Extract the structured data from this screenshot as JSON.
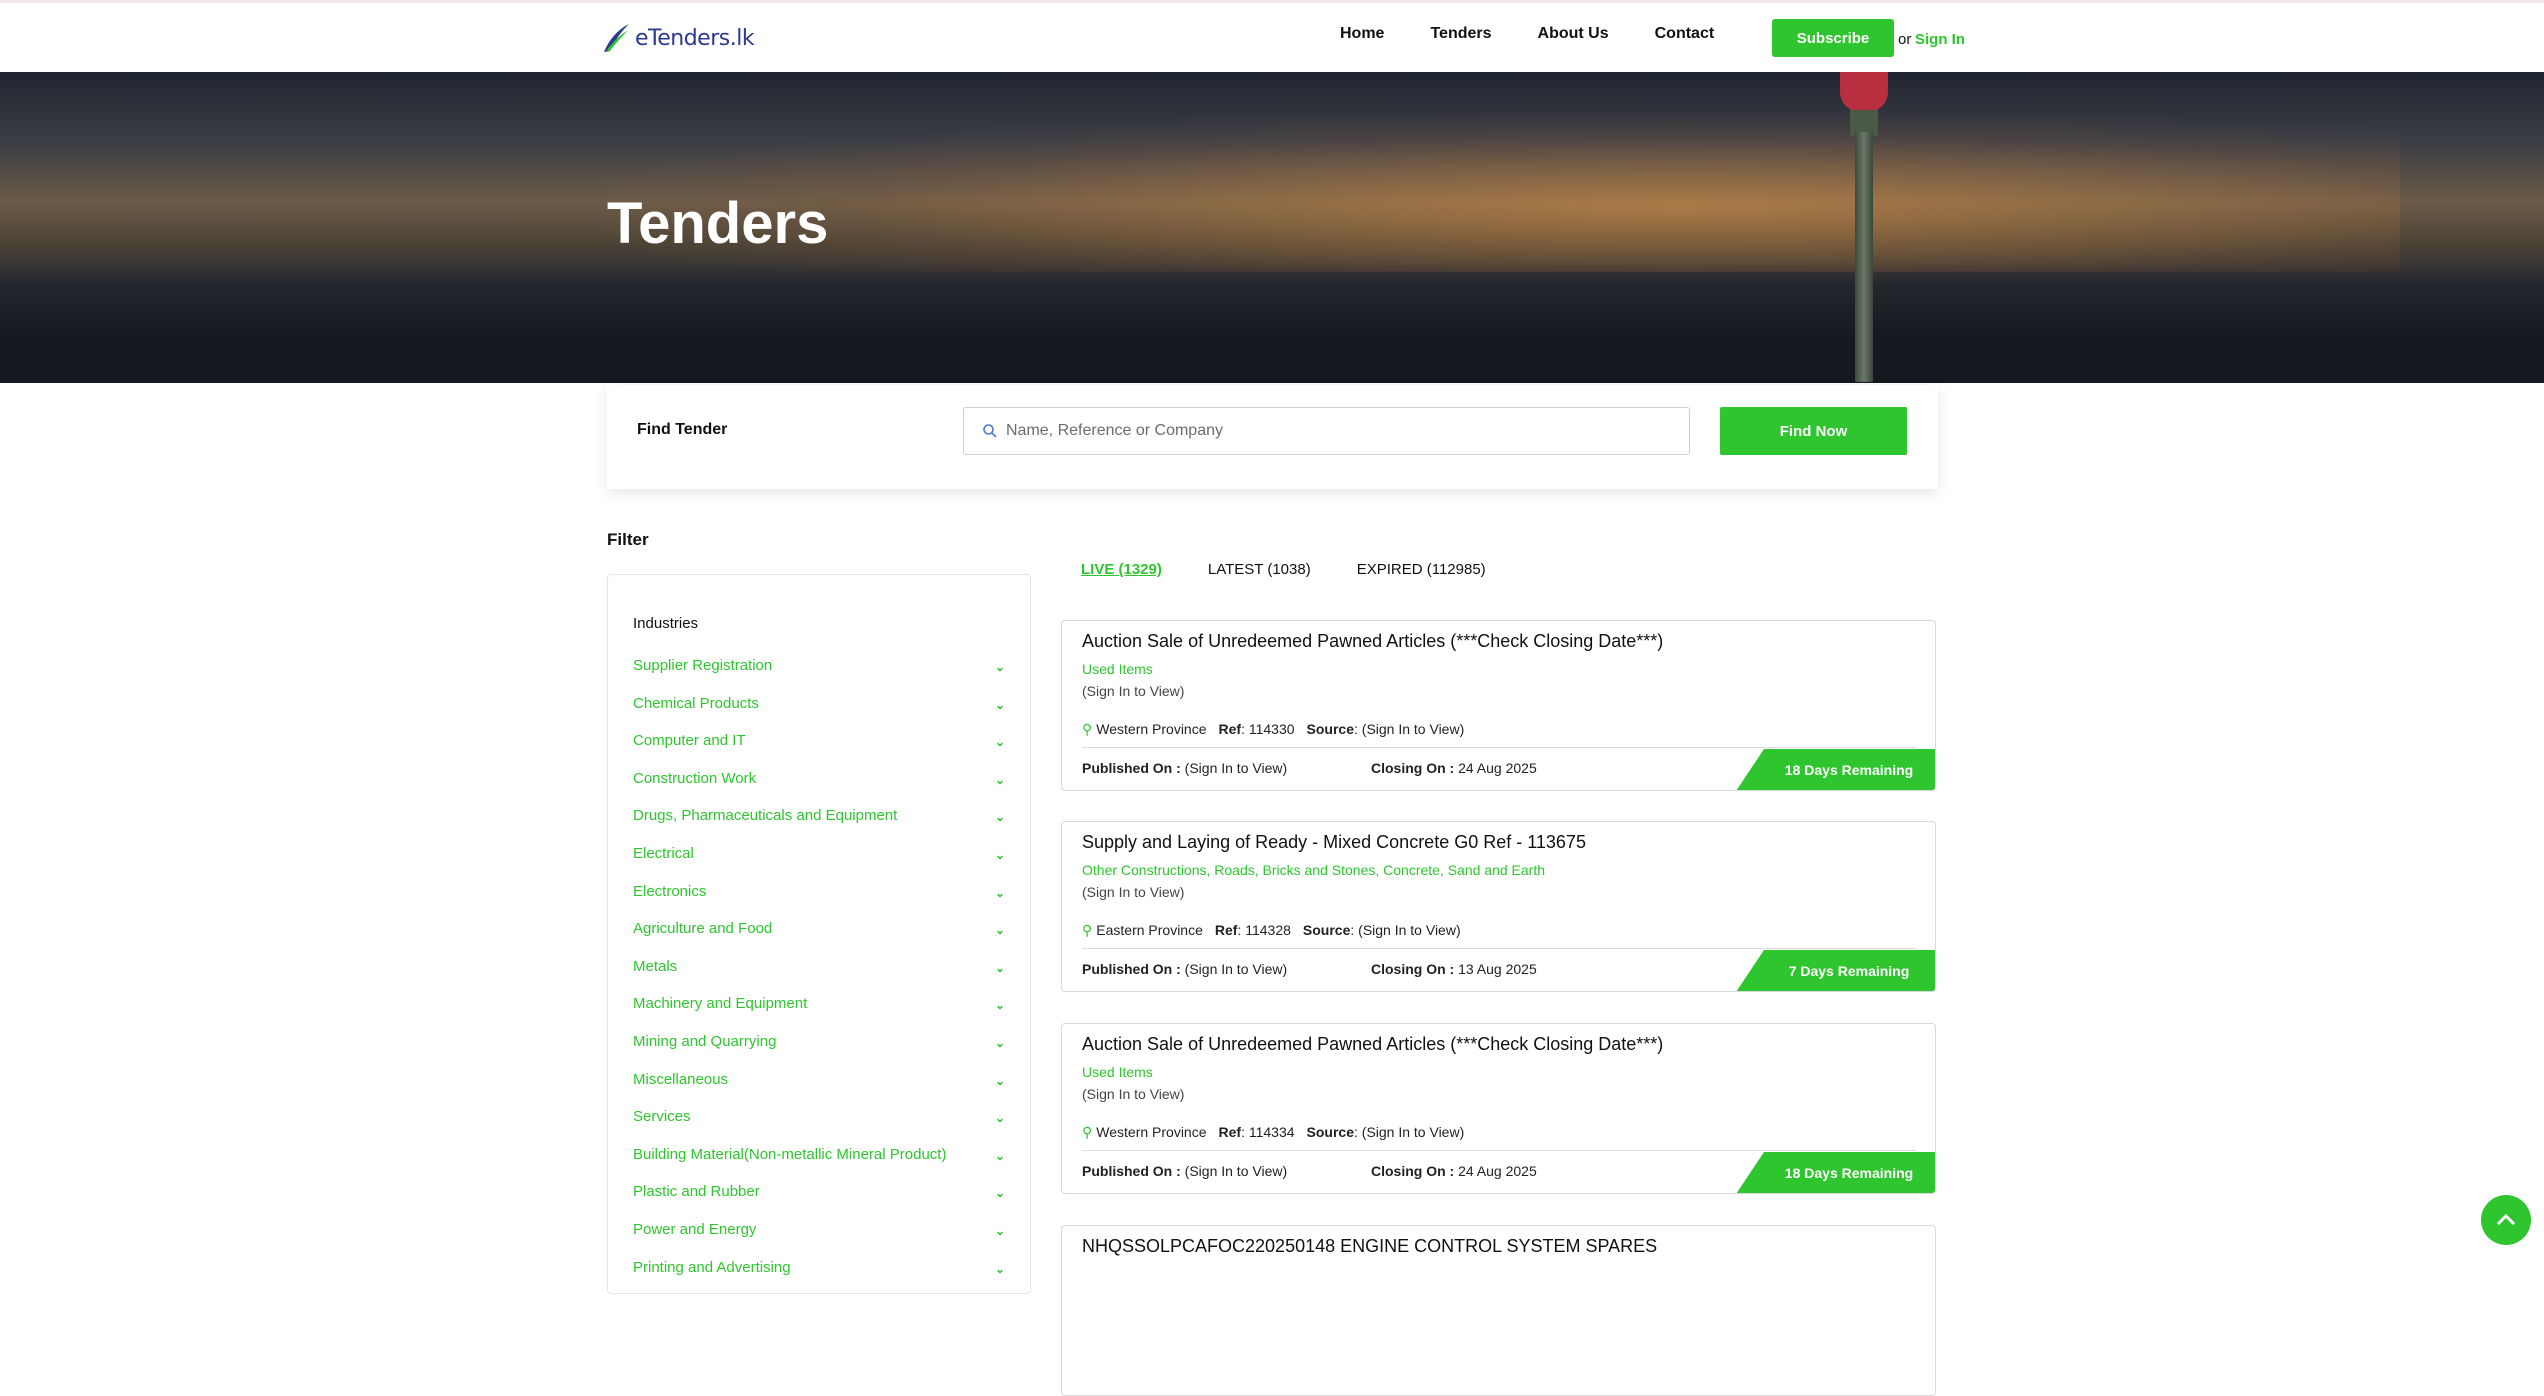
{
  "brand": {
    "logo_text": "eTenders.lk"
  },
  "nav": {
    "links": [
      "Home",
      "Tenders",
      "About Us",
      "Contact"
    ],
    "subscribe": "Subscribe",
    "or": "or",
    "sign_in": "Sign In"
  },
  "hero": {
    "title": "Tenders"
  },
  "search": {
    "label": "Find Tender",
    "placeholder": "Name, Reference or Company",
    "button": "Find Now"
  },
  "filter": {
    "title": "Filter",
    "industries_title": "Industries",
    "industries": [
      "Supplier Registration",
      "Chemical Products",
      "Computer and IT",
      "Construction Work",
      "Drugs, Pharmaceuticals and Equipment",
      "Electrical",
      "Electronics",
      "Agriculture and Food",
      "Metals",
      "Machinery and Equipment",
      "Mining and Quarrying",
      "Miscellaneous",
      "Services",
      "Building Material(Non-metallic Mineral Product)",
      "Plastic and Rubber",
      "Power and Energy",
      "Printing and Advertising"
    ]
  },
  "tabs": [
    {
      "label": "LIVE (1329)",
      "active": true
    },
    {
      "label": "LATEST (1038)",
      "active": false
    },
    {
      "label": "EXPIRED (112985)",
      "active": false
    }
  ],
  "tenders": [
    {
      "title": "Auction Sale of Unredeemed Pawned Articles (***Check Closing Date***)",
      "category": "Used Items",
      "company": "(Sign In to View)",
      "location": "Western Province",
      "ref_label": "Ref",
      "ref": "114330",
      "source_label": "Source",
      "source": "(Sign In to View)",
      "published_label": "Published On :",
      "published": "(Sign In to View)",
      "closing_label": "Closing On :",
      "closing": "24 Aug 2025",
      "remaining": "18 Days Remaining"
    },
    {
      "title": "Supply and Laying of Ready - Mixed Concrete G0 Ref - 113675",
      "category": "Other Constructions, Roads, Bricks and Stones, Concrete, Sand and Earth",
      "company": "(Sign In to View)",
      "location": "Eastern Province",
      "ref_label": "Ref",
      "ref": "114328",
      "source_label": "Source",
      "source": "(Sign In to View)",
      "published_label": "Published On :",
      "published": "(Sign In to View)",
      "closing_label": "Closing On :",
      "closing": "13 Aug 2025",
      "remaining": "7 Days Remaining"
    },
    {
      "title": "Auction Sale of Unredeemed Pawned Articles (***Check Closing Date***)",
      "category": "Used Items",
      "company": "(Sign In to View)",
      "location": "Western Province",
      "ref_label": "Ref",
      "ref": "114334",
      "source_label": "Source",
      "source": "(Sign In to View)",
      "published_label": "Published On :",
      "published": "(Sign In to View)",
      "closing_label": "Closing On :",
      "closing": "24 Aug 2025",
      "remaining": "18 Days Remaining"
    },
    {
      "title": "NHQSSOLPCAFOC220250148 ENGINE CONTROL SYSTEM SPARES"
    }
  ],
  "colors": {
    "accent": "#2fc52f",
    "brand_blue": "#2b3a8f"
  },
  "icons": {
    "search": "search-icon",
    "location": "map-pin-icon",
    "chevron": "chevron-down-icon",
    "scroll_top": "chevron-up-icon"
  }
}
